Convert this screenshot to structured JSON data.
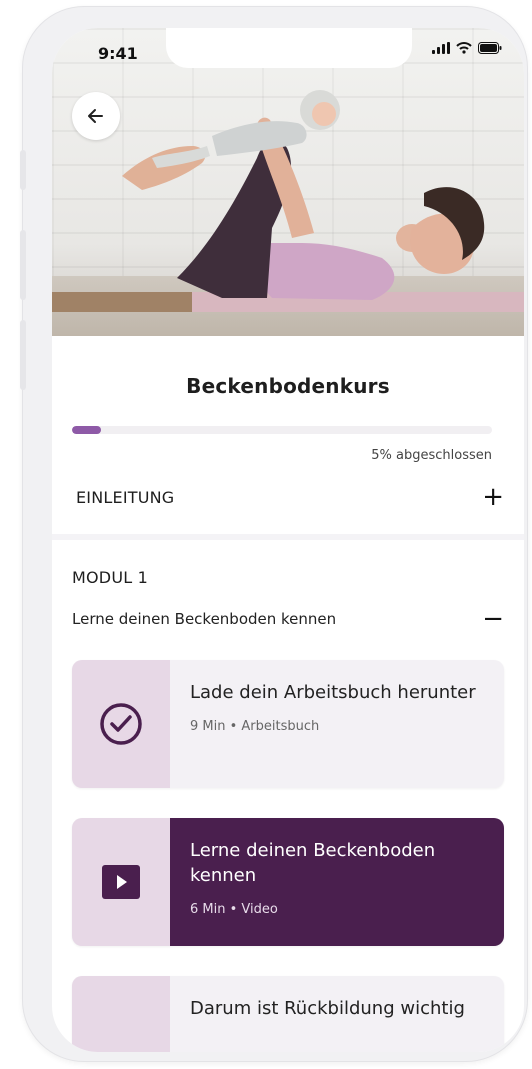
{
  "status_bar": {
    "time": "9:41",
    "icons": [
      "signal-icon",
      "wifi-icon",
      "battery-icon"
    ]
  },
  "hero": {
    "back_icon": "arrow-left-icon"
  },
  "course": {
    "title": "Beckenbodenkurs",
    "progress_percent": 5,
    "progress_text": "5% abgeschlossen"
  },
  "sections": [
    {
      "label": "EINLEITUNG",
      "toggle": "+"
    },
    {
      "label": "MODUL 1",
      "subtitle": "Lerne deinen Beckenboden kennen",
      "toggle": "−"
    }
  ],
  "lessons": [
    {
      "title": "Lade dein Arbeitsbuch herunter",
      "meta": "9 Min • Arbeitsbuch",
      "icon": "check-circle-icon",
      "state": "done"
    },
    {
      "title": "Lerne deinen Beckenboden kennen",
      "meta": "6 Min • Video",
      "icon": "play-icon",
      "state": "active"
    },
    {
      "title": "Darum ist Rückbildung wichtig",
      "meta": "",
      "icon": "lock-icon",
      "state": "locked"
    }
  ],
  "colors": {
    "accent": "#8e5aa7",
    "active_card": "#4a1f4e",
    "icon_box": "#e7d8e6",
    "card_bg": "#f3f1f5"
  }
}
